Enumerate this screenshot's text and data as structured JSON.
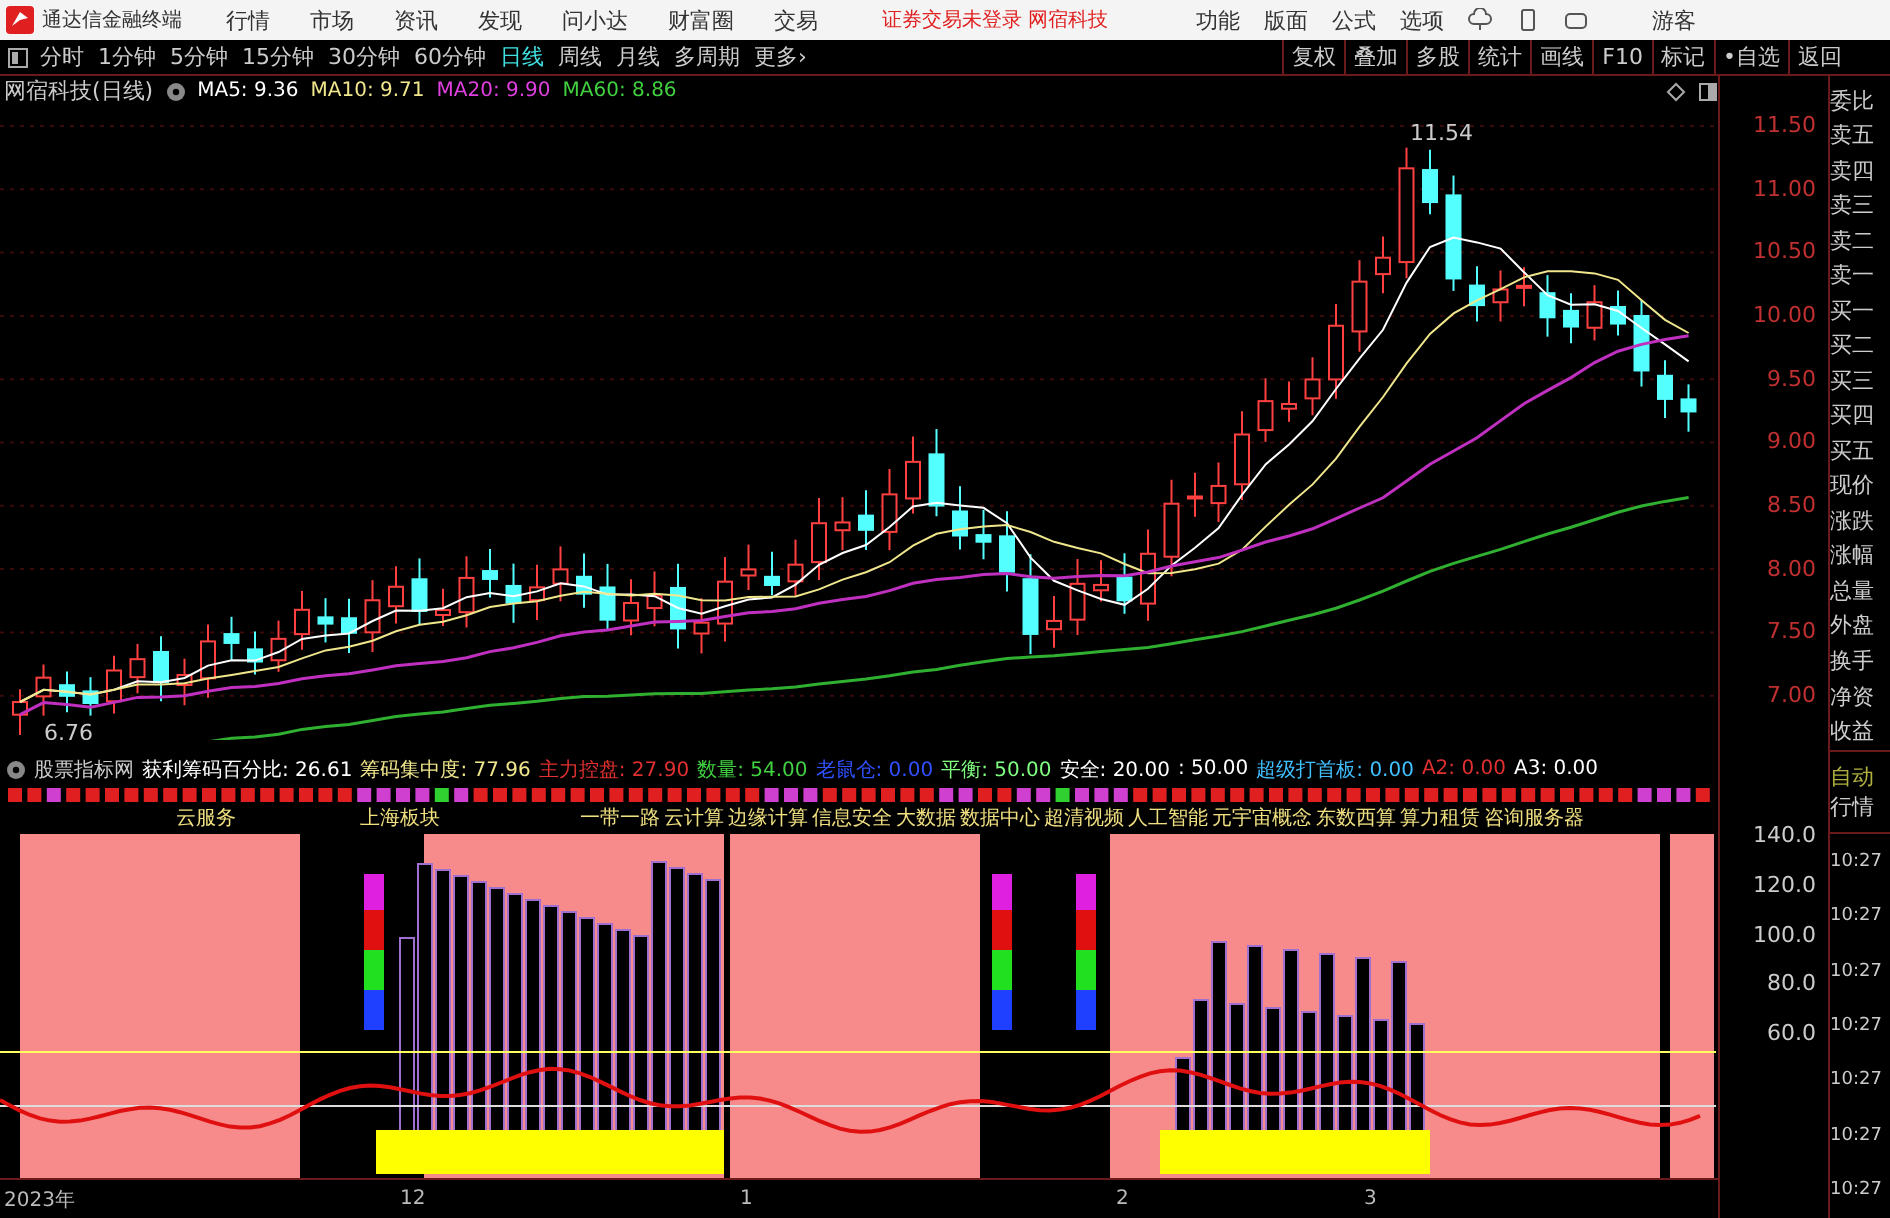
{
  "title_bar": {
    "app_name": "通达信金融终端",
    "menu": [
      "行情",
      "市场",
      "资讯",
      "发现",
      "问小达",
      "财富圈",
      "交易"
    ],
    "notice": "证券交易未登录 网宿科技",
    "actions": [
      "功能",
      "版面",
      "公式",
      "选项"
    ],
    "user": "游客"
  },
  "period_tabs": [
    {
      "label": "分时",
      "selected": false
    },
    {
      "label": "1分钟",
      "selected": false
    },
    {
      "label": "5分钟",
      "selected": false
    },
    {
      "label": "15分钟",
      "selected": false
    },
    {
      "label": "30分钟",
      "selected": false
    },
    {
      "label": "60分钟",
      "selected": false
    },
    {
      "label": "日线",
      "selected": true
    },
    {
      "label": "周线",
      "selected": false
    },
    {
      "label": "月线",
      "selected": false
    },
    {
      "label": "多周期",
      "selected": false
    },
    {
      "label": "更多›",
      "selected": false
    }
  ],
  "tool_buttons": [
    "复权",
    "叠加",
    "多股",
    "统计",
    "画线",
    "F10",
    "标记",
    "•自选",
    "返回"
  ],
  "chart_header": {
    "title": "网宿科技(日线)",
    "ma": [
      {
        "label": "MA5: 9.36",
        "color": "#ffffff"
      },
      {
        "label": "MA10: 9.71",
        "color": "#f0e68c"
      },
      {
        "label": "MA20: 9.90",
        "color": "#e040e0"
      },
      {
        "label": "MA60: 8.86",
        "color": "#40d040"
      }
    ]
  },
  "price_axis": [
    "11.50",
    "11.00",
    "10.50",
    "10.00",
    "9.50",
    "9.00",
    "8.50",
    "8.00",
    "7.50",
    "7.00"
  ],
  "price_marks": {
    "high": "11.54",
    "low": "6.76"
  },
  "indicator_header": {
    "title": "股票指标网",
    "values": [
      {
        "label": "获利筹码百分比: 26.61",
        "color": "#ffffff"
      },
      {
        "label": "筹码集中度: 77.96",
        "color": "#f0e68c"
      },
      {
        "label": "主力控盘: 27.90",
        "color": "#e03030"
      },
      {
        "label": "数量: 54.00",
        "color": "#40d040"
      },
      {
        "label": "老鼠仓: 0.00",
        "color": "#3050ff"
      },
      {
        "label": "平衡: 50.00",
        "color": "#80ff80"
      },
      {
        "label": "安全: 20.00",
        "color": "#ffffff"
      },
      {
        "label": ": 50.00",
        "color": "#ffffff"
      },
      {
        "label": "超级打首板: 0.00",
        "color": "#40c0ff"
      },
      {
        "label": "A2: 0.00",
        "color": "#e03030"
      },
      {
        "label": "A3: 0.00",
        "color": "#ffffff"
      }
    ]
  },
  "sector_labels": [
    "云服务",
    "上海板块",
    "一带一路",
    "云计算",
    "边缘计算",
    "信息安全",
    "大数据",
    "数据中心",
    "超清视频",
    "人工智能",
    "元宇宙概念",
    "东数西算",
    "算力租赁",
    "咨询服务器"
  ],
  "sub_axis": [
    "140.0",
    "120.0",
    "100.0",
    "80.0",
    "60.0"
  ],
  "side_panel": {
    "quote_labels": [
      "委比",
      "卖五",
      "卖四",
      "卖三",
      "卖二",
      "卖一",
      "买一",
      "买二",
      "买三",
      "买四",
      "买五",
      "现价",
      "涨跌",
      "涨幅",
      "总量",
      "外盘",
      "换手",
      "净资",
      "收益"
    ],
    "mode_labels": [
      "自动",
      "行情"
    ],
    "times": [
      "10:27",
      "10:27",
      "10:27",
      "10:27",
      "10:27",
      "10:27",
      "10:27"
    ]
  },
  "date_axis": [
    "2023年",
    "12",
    "1",
    "2",
    "3"
  ]
}
